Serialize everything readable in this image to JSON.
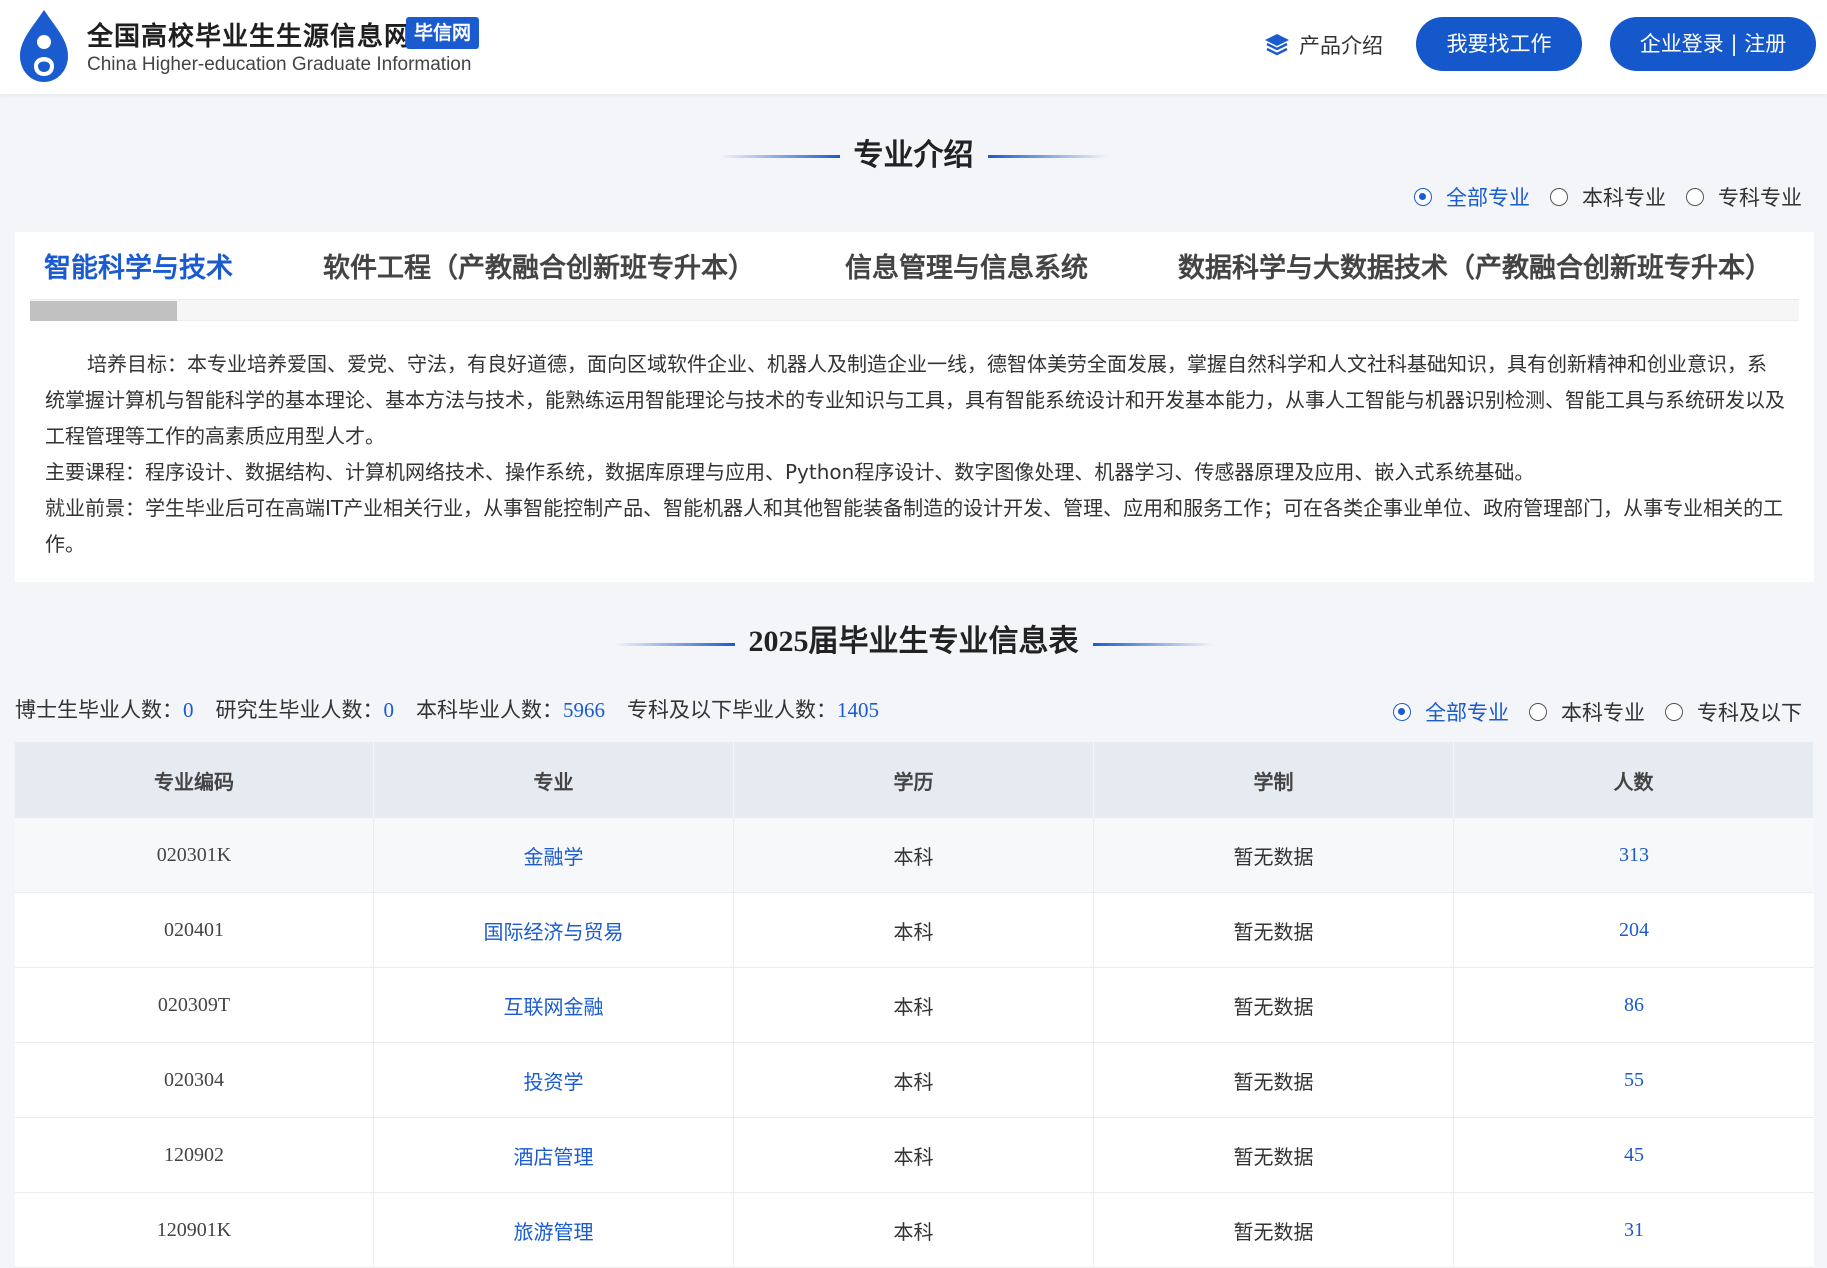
{
  "header": {
    "brand_title": "全国高校毕业生生源信息网",
    "brand_tag": "毕信网",
    "brand_subtitle": "China Higher-education Graduate Information",
    "product_link": "产品介绍",
    "find_job_button": "我要找工作",
    "enterprise_button": "企业登录 | 注册",
    "colors": {
      "primary": "#1a5bcf"
    }
  },
  "intro": {
    "title": "专业介绍",
    "filters": [
      {
        "label": "全部专业",
        "active": true
      },
      {
        "label": "本科专业",
        "active": false
      },
      {
        "label": "专科专业",
        "active": false
      }
    ],
    "tabs": [
      {
        "label": "智能科学与技术",
        "active": true
      },
      {
        "label": "软件工程（产教融合创新班专升本）",
        "active": false
      },
      {
        "label": "信息管理与信息系统",
        "active": false
      },
      {
        "label": "数据科学与大数据技术（产教融合创新班专升本）",
        "active": false
      }
    ],
    "description": {
      "goal": "培养目标：本专业培养爱国、爱党、守法，有良好道德，面向区域软件企业、机器人及制造企业一线，德智体美劳全面发展，掌握自然科学和人文社科基础知识，具有创新精神和创业意识，系统掌握计算机与智能科学的基本理论、基本方法与技术，能熟练运用智能理论与技术的专业知识与工具，具有智能系统设计和开发基本能力，从事人工智能与机器识别检测、智能工具与系统研发以及工程管理等工作的高素质应用型人才。",
      "courses": "主要课程：程序设计、数据结构、计算机网络技术、操作系统，数据库原理与应用、Python程序设计、数字图像处理、机器学习、传感器原理及应用、嵌入式系统基础。",
      "prospects": "就业前景：学生毕业后可在高端IT产业相关行业，从事智能控制产品、智能机器人和其他智能装备制造的设计开发、管理、应用和服务工作；可在各类企事业单位、政府管理部门，从事专业相关的工作。"
    }
  },
  "info_table": {
    "title": "2025届毕业生专业信息表",
    "stats": [
      {
        "label": "博士生毕业人数：",
        "value": "0"
      },
      {
        "label": "研究生毕业人数：",
        "value": "0"
      },
      {
        "label": "本科毕业人数：",
        "value": "5966"
      },
      {
        "label": "专科及以下毕业人数：",
        "value": "1405"
      }
    ],
    "filters": [
      {
        "label": "全部专业",
        "active": true
      },
      {
        "label": "本科专业",
        "active": false
      },
      {
        "label": "专科及以下",
        "active": false
      }
    ],
    "columns": [
      "专业编码",
      "专业",
      "学历",
      "学制",
      "人数"
    ],
    "rows": [
      {
        "code": "020301K",
        "major": "金融学",
        "degree": "本科",
        "duration": "暂无数据",
        "count": "313"
      },
      {
        "code": "020401",
        "major": "国际经济与贸易",
        "degree": "本科",
        "duration": "暂无数据",
        "count": "204"
      },
      {
        "code": "020309T",
        "major": "互联网金融",
        "degree": "本科",
        "duration": "暂无数据",
        "count": "86"
      },
      {
        "code": "020304",
        "major": "投资学",
        "degree": "本科",
        "duration": "暂无数据",
        "count": "55"
      },
      {
        "code": "120902",
        "major": "酒店管理",
        "degree": "本科",
        "duration": "暂无数据",
        "count": "45"
      },
      {
        "code": "120901K",
        "major": "旅游管理",
        "degree": "本科",
        "duration": "暂无数据",
        "count": "31"
      }
    ]
  }
}
